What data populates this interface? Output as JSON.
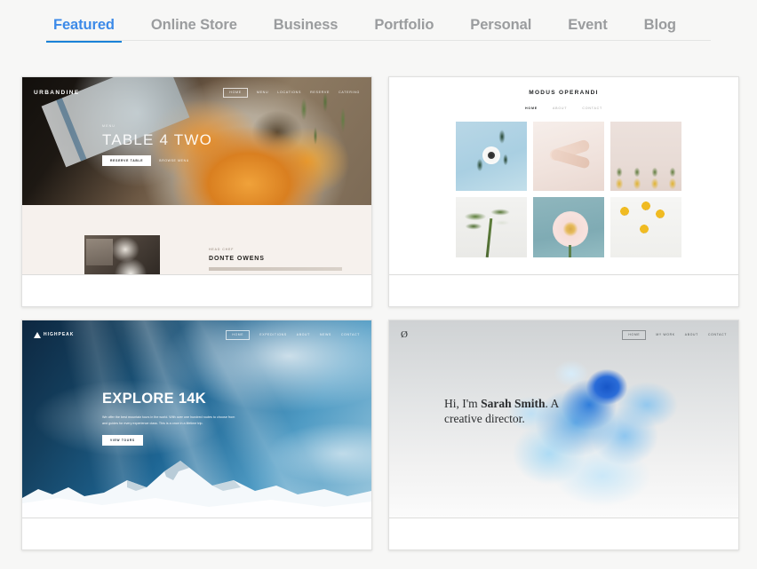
{
  "tabs": [
    {
      "label": "Featured",
      "active": true
    },
    {
      "label": "Online Store",
      "active": false
    },
    {
      "label": "Business",
      "active": false
    },
    {
      "label": "Portfolio",
      "active": false
    },
    {
      "label": "Personal",
      "active": false
    },
    {
      "label": "Event",
      "active": false
    },
    {
      "label": "Blog",
      "active": false
    }
  ],
  "colors": {
    "accent": "#3c8ae8",
    "underline": "#1a82d8",
    "tab_inactive": "#9a9c9e",
    "page_background": "#f7f7f6",
    "card_background": "#ffffff"
  },
  "templates": [
    {
      "name": "urbandine",
      "logo": "URBANDINE",
      "nav": [
        "HOME",
        "MENU",
        "LOCATIONS",
        "RESERVE",
        "CATERING"
      ],
      "eyebrow": "MENU",
      "headline": "TABLE 4 TWO",
      "primary_button": "RESERVE TABLE",
      "secondary_link": "BROWSE MENU",
      "section_eyebrow": "HEAD CHEF",
      "section_heading": "DONTE OWENS"
    },
    {
      "name": "modus-operandi",
      "logo": "MODUS OPERANDI",
      "nav": [
        "HOME",
        "ABOUT",
        "CONTACT"
      ],
      "gallery": [
        "white-anemone-on-blue",
        "crossed-hands-on-blush",
        "pineapple-row-on-beige",
        "monstera-leaf-on-white",
        "pink-gerbera-on-teal",
        "yellow-billy-buttons-on-white"
      ]
    },
    {
      "name": "highpeak",
      "logo": "HIGHPEAK",
      "nav": [
        "HOME",
        "EXPEDITIONS",
        "ABOUT",
        "NEWS",
        "CONTACT"
      ],
      "headline": "EXPLORE 14K",
      "body": "We offer the best mountain tours in the world. With over one hundred routes to choose from and guides for every experience class. This is a once in a lifetime trip.",
      "primary_button": "VIEW TOURS"
    },
    {
      "name": "sarah-smith",
      "logo": "Ø",
      "nav": [
        "HOME",
        "MY WORK",
        "ABOUT",
        "CONTACT"
      ],
      "headline_before": "Hi, I'm ",
      "headline_name": "Sarah Smith",
      "headline_after": ". A creative director."
    }
  ]
}
